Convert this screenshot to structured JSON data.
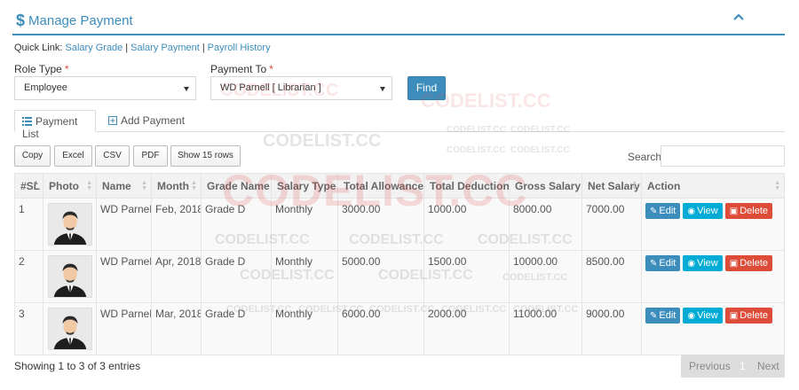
{
  "header": {
    "title": "Manage Payment",
    "title_icon": "dollar-icon",
    "collapse_icon": "chevron-up-icon"
  },
  "quick_links": {
    "label": "Quick Link:",
    "links": [
      "Salary Grade",
      "Salary Payment",
      "Payroll History"
    ]
  },
  "form": {
    "role_type_label": "Role Type",
    "role_type_value": "Employee",
    "payment_to_label": "Payment To",
    "payment_to_value": "WD Parnell [ Librarian ]",
    "required_mark": "*",
    "find_label": "Find"
  },
  "tabs": [
    {
      "label": "Payment List",
      "icon": "list-icon",
      "active": true
    },
    {
      "label": "Add Payment",
      "icon": "plus-square-icon",
      "active": false
    }
  ],
  "export_buttons": [
    "Copy",
    "Excel",
    "CSV",
    "PDF",
    "Show 15 rows"
  ],
  "search": {
    "label": "Search:",
    "value": ""
  },
  "table": {
    "columns": [
      "#SL",
      "Photo",
      "Name",
      "Month",
      "Grade Name",
      "Salary Type",
      "Total Allowance",
      "Total Deduction",
      "Gross Salary",
      "Net Salary",
      "Action"
    ],
    "rows": [
      {
        "sl": "1",
        "name": "WD Parnell",
        "month": "Feb, 2018",
        "grade": "Grade D",
        "type": "Monthly",
        "allowance": "3000.00",
        "deduction": "1000.00",
        "gross": "8000.00",
        "net": "7000.00"
      },
      {
        "sl": "2",
        "name": "WD Parnell",
        "month": "Apr, 2018",
        "grade": "Grade D",
        "type": "Monthly",
        "allowance": "5000.00",
        "deduction": "1500.00",
        "gross": "10000.00",
        "net": "8500.00"
      },
      {
        "sl": "3",
        "name": "WD Parnell",
        "month": "Mar, 2018",
        "grade": "Grade D",
        "type": "Monthly",
        "allowance": "6000.00",
        "deduction": "2000.00",
        "gross": "11000.00",
        "net": "9000.00"
      }
    ],
    "actions": {
      "edit": "Edit",
      "view": "View",
      "delete": "Delete"
    }
  },
  "footer": {
    "info": "Showing 1 to 3 of 3 entries",
    "prev": "Previous",
    "page": "1",
    "next": "Next"
  },
  "watermark": "CODELIST.CC",
  "colors": {
    "primary": "#3c8dbc",
    "info": "#00acd6",
    "danger": "#dd4b39"
  }
}
